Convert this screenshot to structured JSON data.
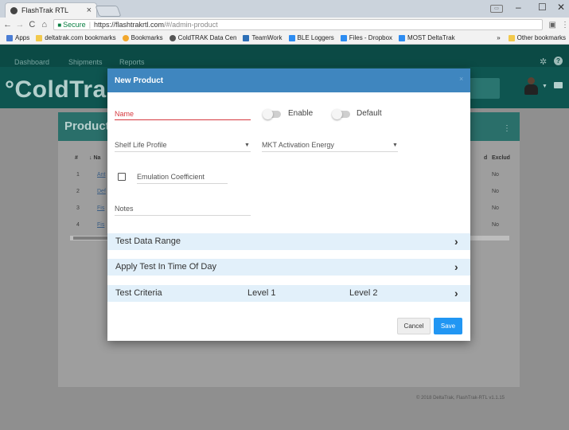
{
  "browser": {
    "tab_title": "FlashTrak RTL",
    "tab_close": "×",
    "window_controls": [
      "–",
      "☐",
      "✕"
    ],
    "secure_label": "Secure",
    "url_host": "https://flashtrakrtl.com",
    "url_path": "/#/admin-product",
    "bookmarks": [
      {
        "label": "Apps",
        "icon": "apps-grid-icon",
        "color": "#4a7dd4"
      },
      {
        "label": "deltatrak.com bookmarks",
        "icon": "folder-icon",
        "color": "#f2c94c"
      },
      {
        "label": "Bookmarks",
        "icon": "star-icon",
        "color": "#f2a72c"
      },
      {
        "label": "ColdTRAK Data Cen",
        "icon": "flashtrak-icon",
        "color": "#555555"
      },
      {
        "label": "TeamWork",
        "icon": "teamwork-icon",
        "color": "#2d6fb6"
      },
      {
        "label": "BLE Loggers",
        "icon": "drive-icon",
        "color": "#2c8cf2"
      },
      {
        "label": "Files - Dropbox",
        "icon": "dropbox-icon",
        "color": "#2c8cf2"
      },
      {
        "label": "MOST DeltaTrak",
        "icon": "drive-icon",
        "color": "#2c8cf2"
      }
    ],
    "bookmarks_overflow": "»",
    "other_bookmarks": "Other bookmarks"
  },
  "app": {
    "nav": [
      "Dashboard",
      "Shipments",
      "Reports"
    ],
    "logo": "°ColdTra",
    "card_title": "Products",
    "table_headers": [
      "#",
      "↓ Na",
      "d",
      "Exclud"
    ],
    "rows": [
      {
        "num": "1",
        "name": "Ant",
        "excl": "No"
      },
      {
        "num": "2",
        "name": "Def",
        "excl": "No"
      },
      {
        "num": "3",
        "name": "Fis",
        "excl": "No"
      },
      {
        "num": "4",
        "name": "Fis",
        "excl": "No"
      }
    ],
    "footer": "© 2018 DeltaTrak, FlashTrak-RTL v1.1.15"
  },
  "modal": {
    "title": "New Product",
    "close": "×",
    "name_label": "Name",
    "enable_label": "Enable",
    "default_label": "Default",
    "shelf_life_label": "Shelf Life Profile",
    "mkt_label": "MKT Activation Energy",
    "emulation_label": "Emulation Coefficient",
    "notes_label": "Notes",
    "sections": [
      {
        "label": "Test Data Range",
        "level1": "",
        "level2": ""
      },
      {
        "label": "Apply Test In Time Of Day",
        "level1": "",
        "level2": ""
      },
      {
        "label": "Test Criteria",
        "level1": "Level 1",
        "level2": "Level 2"
      }
    ],
    "cancel": "Cancel",
    "save": "Save"
  },
  "colors": {
    "modal_header": "#3f86bf",
    "accordion_bg": "#e2f0fa",
    "save_button": "#2196f3",
    "required_accent": "#d6393f"
  }
}
